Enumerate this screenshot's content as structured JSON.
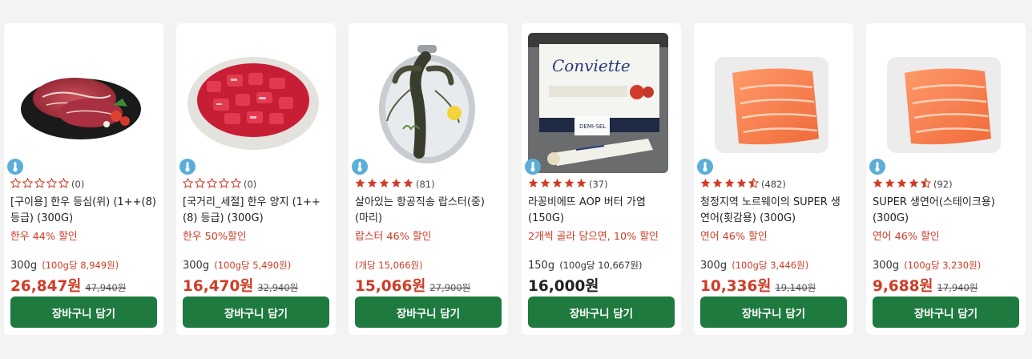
{
  "colors": {
    "accent_red": "#d03c26",
    "button_green": "#1e7a3e",
    "star_red": "#d03c26",
    "temp_badge": "#5aaed8"
  },
  "products": [
    {
      "rating": "(0)",
      "stars": 0,
      "name": "[구이용] 한우 등심(위) (1++(8) 등급) (300G)",
      "promo": "한우 44% 할인",
      "unit": "300g",
      "unit_price": "(100g당 8,949원)",
      "price": "26,847원",
      "original_price": "47,940원",
      "button": "장바구니 담기",
      "image": "beef-steak-plate"
    },
    {
      "rating": "(0)",
      "stars": 0,
      "name": "[국거리_세절] 한우 양지 (1++(8) 등급) (300G)",
      "promo": "한우 50%할인",
      "unit": "300g",
      "unit_price": "(100g당 5,490원)",
      "price": "16,470원",
      "original_price": "32,940원",
      "button": "장바구니 담기",
      "image": "beef-cubes-bowl"
    },
    {
      "rating": "(81)",
      "stars": 5,
      "name": "살아있는 항공직송 랍스터(중) (마리)",
      "promo": "랍스터 46% 할인",
      "unit": "",
      "unit_price": "(개당 15,066원)",
      "price": "15,066원",
      "original_price": "27,900원",
      "button": "장바구니 담기",
      "image": "lobster-tray"
    },
    {
      "rating": "(37)",
      "stars": 5,
      "name": "라꽁비에뜨 AOP 버터 가염 (150G)",
      "promo": "2개씩 골라 담으면, 10% 할인",
      "unit": "150g",
      "unit_price": "(100g당 10,667원)",
      "price": "16,000원",
      "original_price": "",
      "button": "장바구니 담기",
      "image": "butter-box"
    },
    {
      "rating": "(482)",
      "stars": 4.5,
      "name": "청정지역 노르웨이의 SUPER 생연어(횟감용) (300G)",
      "promo": "연어 46% 할인",
      "unit": "300g",
      "unit_price": "(100g당 3,446원)",
      "price": "10,336원",
      "original_price": "19,140원",
      "button": "장바구니 담기",
      "image": "salmon-fillet"
    },
    {
      "rating": "(92)",
      "stars": 4.5,
      "name": "SUPER 생연어(스테이크용) (300G)",
      "promo": "연어 46% 할인",
      "unit": "300g",
      "unit_price": "(100g당 3,230원)",
      "price": "9,688원",
      "original_price": "17,940원",
      "button": "장바구니 담기",
      "image": "salmon-fillet"
    }
  ]
}
